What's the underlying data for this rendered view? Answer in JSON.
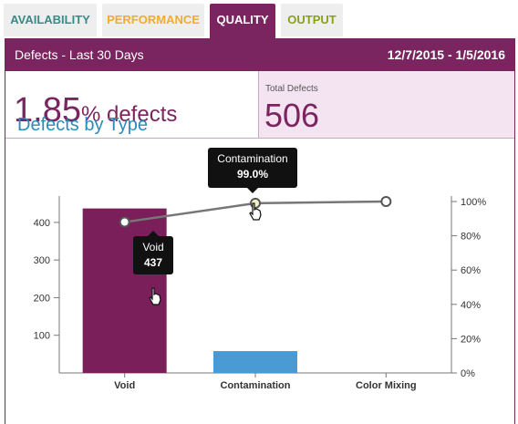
{
  "tabs": [
    {
      "label": "AVAILABILITY",
      "color": "#3a8a86"
    },
    {
      "label": "PERFORMANCE",
      "color": "#f0ad2a"
    },
    {
      "label": "QUALITY",
      "color": "#7b2560",
      "active": true
    },
    {
      "label": "OUTPUT",
      "color": "#88a01d"
    }
  ],
  "header": {
    "title": "Defects - Last 30 Days",
    "date_range": "12/7/2015 - 1/5/2016"
  },
  "stats": {
    "rate_value": "1.85",
    "rate_unit": "% defects",
    "total_label": "Total Defects",
    "total_value": "506"
  },
  "chart_title": "Defects by Type",
  "tooltips": {
    "void": {
      "label": "Void",
      "value": "437"
    },
    "contamination": {
      "label": "Contamination",
      "value": "99.0%"
    }
  },
  "colors": {
    "accent": "#7b2560",
    "bar_void": "#7b1f5a",
    "bar_contamination": "#4a9ad4",
    "line": "#777777",
    "title": "#2a8bb8"
  },
  "chart_data": {
    "type": "bar",
    "categories": [
      "Void",
      "Contamination",
      "Color Mixing"
    ],
    "series": [
      {
        "type": "bar",
        "values": [
          437,
          58,
          0
        ]
      },
      {
        "type": "line",
        "axis": "right",
        "values": [
          88,
          99,
          100
        ]
      }
    ],
    "ylim": [
      0,
      470
    ],
    "yticks": [
      100,
      200,
      300,
      400
    ],
    "y2lim": [
      0,
      100
    ],
    "y2ticks": [
      "0%",
      "20%",
      "40%",
      "60%",
      "80%",
      "100%"
    ],
    "grid": false
  }
}
